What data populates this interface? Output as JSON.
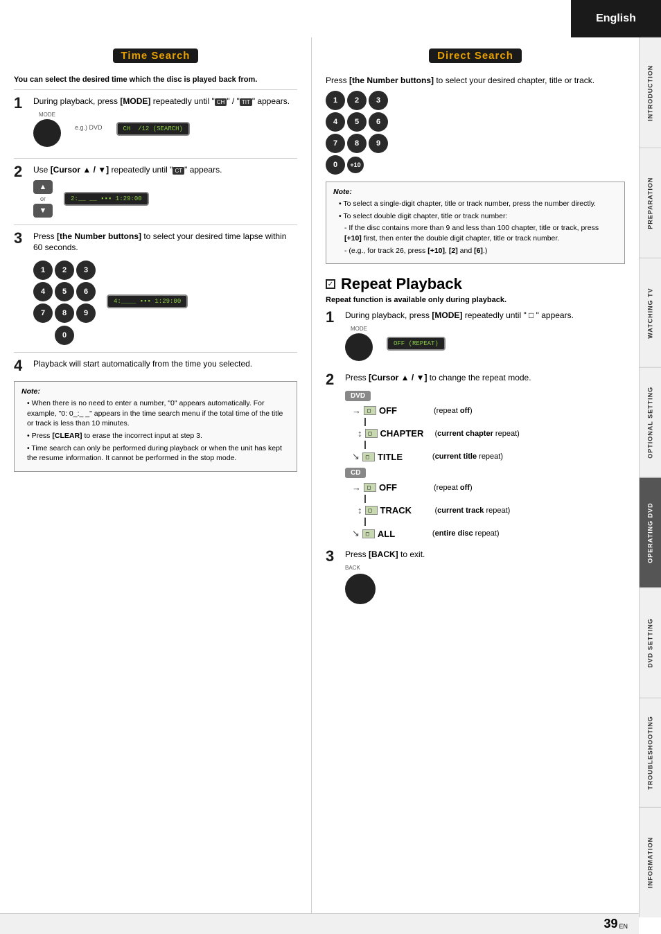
{
  "header": {
    "language": "English"
  },
  "sidebar": {
    "sections": [
      {
        "id": "introduction",
        "label": "INTRODUCTION",
        "active": false
      },
      {
        "id": "preparation",
        "label": "PREPARATION",
        "active": false
      },
      {
        "id": "watching-tv",
        "label": "WATCHING TV",
        "active": false
      },
      {
        "id": "optional-setting",
        "label": "OPTIONAL SETTING",
        "active": false
      },
      {
        "id": "operating-dvd",
        "label": "OPERATING DVD",
        "active": true
      },
      {
        "id": "dvd-setting",
        "label": "DVD SETTING",
        "active": false
      },
      {
        "id": "troubleshooting",
        "label": "TROUBLESHOOTING",
        "active": false
      },
      {
        "id": "information",
        "label": "INFORMATION",
        "active": false
      }
    ]
  },
  "page": {
    "number": "39",
    "suffix": "EN"
  },
  "time_search": {
    "title": "Time Search",
    "subtitle": "You can select the desired time which the disc is played back from.",
    "step1": {
      "num": "1",
      "text": "During playback, press ",
      "bold": "[MODE]",
      "text2": " repeatedly until “",
      "icon1": "CH",
      "text3": "” / “",
      "icon2": "TIT",
      "text4": "” appears.",
      "eg_label": "e.g.) DVD",
      "screen1": "CH  /12 (SEARCH)"
    },
    "step2": {
      "num": "2",
      "text": "Use ",
      "bold": "[Cursor ▲ / ▼]",
      "text2": " repeatedly until “",
      "icon": "CT",
      "text3": "” appears.",
      "screen": "2:__ __ ■■■ 1:29:00"
    },
    "step3": {
      "num": "3",
      "text": "Press ",
      "bold": "[the Number buttons]",
      "text2": " to select your desired time lapse within 60 seconds.",
      "numbers": [
        "1",
        "2",
        "3",
        "4",
        "5",
        "6",
        "7",
        "8",
        "9",
        "0"
      ],
      "screen": "4:____ ■■■ 1:29:00"
    },
    "step4": {
      "num": "4",
      "text": "Playback will start automatically from the time you selected."
    },
    "note": {
      "title": "Note:",
      "items": [
        "When there is no need to enter a number, “0” appears automatically. For example, “0: 0_:_ _” appears in the time search menu if the total time of the title or track is less than 10 minutes.",
        "Press [CLEAR] to erase the incorrect input at step 3.",
        "Time search can only be performed during playback or when the unit has kept the resume information. It cannot be performed in the stop mode."
      ]
    }
  },
  "direct_search": {
    "title": "Direct Search",
    "text": "Press ",
    "bold": "[the Number buttons]",
    "text2": " to select your desired chapter, title or track.",
    "numbers": [
      "1",
      "2",
      "3",
      "4",
      "5",
      "6",
      "7",
      "8",
      "9",
      "0",
      "+10"
    ],
    "note": {
      "title": "Note:",
      "items": [
        "To select a single-digit chapter, title or track number, press the number directly.",
        "To select double digit chapter, title or track number:"
      ],
      "sub_items": [
        "If the disc contains more than 9 and less than 100 chapter, title or track, press [+10] first, then enter the double digit chapter, title or track number.",
        "(e.g., for track 26, press [+10], [2] and [6].)"
      ]
    }
  },
  "repeat_playback": {
    "title": "Repeat Playback",
    "subtitle": "Repeat function is available only during playback.",
    "step1": {
      "num": "1",
      "text": "During playback, press ",
      "bold": "[MODE]",
      "text2": " repeatedly until “ □ ” appears.",
      "screen": "OFF (REPEAT)"
    },
    "step2": {
      "num": "2",
      "text": "Press ",
      "bold": "[Cursor ▲ / ▼]",
      "text2": " to change the repeat mode.",
      "dvd_label": "DVD",
      "dvd_modes": [
        {
          "word": "OFF",
          "desc": "(repeat off)"
        },
        {
          "word": "CHAPTER",
          "desc": "(current chapter repeat)"
        },
        {
          "word": "TITLE",
          "desc": "(current title repeat)"
        }
      ],
      "cd_label": "CD",
      "cd_modes": [
        {
          "word": "OFF",
          "desc": "(repeat off)"
        },
        {
          "word": "TRACK",
          "desc": "(current track repeat)"
        },
        {
          "word": "ALL",
          "desc": "(entire disc repeat)"
        }
      ]
    },
    "step3": {
      "num": "3",
      "text": "Press ",
      "bold": "[BACK]",
      "text2": " to exit.",
      "button_label": "BACK"
    }
  }
}
